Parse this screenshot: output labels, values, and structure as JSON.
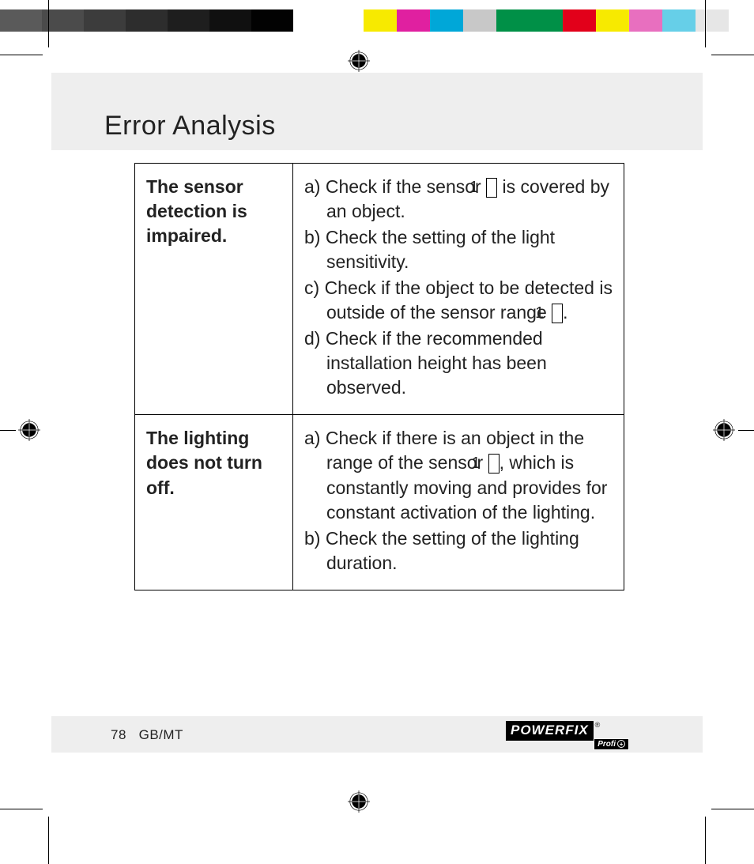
{
  "title": "Error Analysis",
  "ref_label": "1",
  "rows": [
    {
      "problem": "The sensor detection is impaired.",
      "solutions": [
        {
          "prefix": "a)",
          "segments": [
            {
              "t": "Check if the sensor "
            },
            {
              "ref": true
            },
            {
              "t": " is covered by an object."
            }
          ]
        },
        {
          "prefix": "b)",
          "segments": [
            {
              "t": "Check the setting of the light sensitivity."
            }
          ]
        },
        {
          "prefix": "c)",
          "segments": [
            {
              "t": "Check if the object to be detected is outside of the sensor range "
            },
            {
              "ref": true
            },
            {
              "t": "."
            }
          ]
        },
        {
          "prefix": "d)",
          "segments": [
            {
              "t": "Check if the recommended installation height has been observed."
            }
          ]
        }
      ]
    },
    {
      "problem": "The lighting does not turn off.",
      "solutions": [
        {
          "prefix": "a)",
          "segments": [
            {
              "t": "Check if there is an object in the range of the sensor "
            },
            {
              "ref": true
            },
            {
              "t": ", which is constantly moving and provides for constant activation of the lighting."
            }
          ]
        },
        {
          "prefix": "b)",
          "segments": [
            {
              "t": "Check the setting of the lighting duration."
            }
          ]
        }
      ]
    }
  ],
  "footer": {
    "page": "78",
    "region": "GB/MT"
  },
  "brand": {
    "name": "POWERFIX",
    "sub": "Profi",
    "reg": "®"
  },
  "colors_left": [
    "#5a5a5a",
    "#4b4b4b",
    "#3c3c3c",
    "#2d2d2d",
    "#1e1e1e",
    "#101010",
    "#020202",
    "#ffffff"
  ],
  "colors_right": [
    "#f7ea00",
    "#e020a0",
    "#00a7d8",
    "#c8c8c8",
    "#009047",
    "#009047",
    "#e2001a",
    "#f7ea00",
    "#e86fbf",
    "#66cfe8",
    "#e6e6e6"
  ]
}
